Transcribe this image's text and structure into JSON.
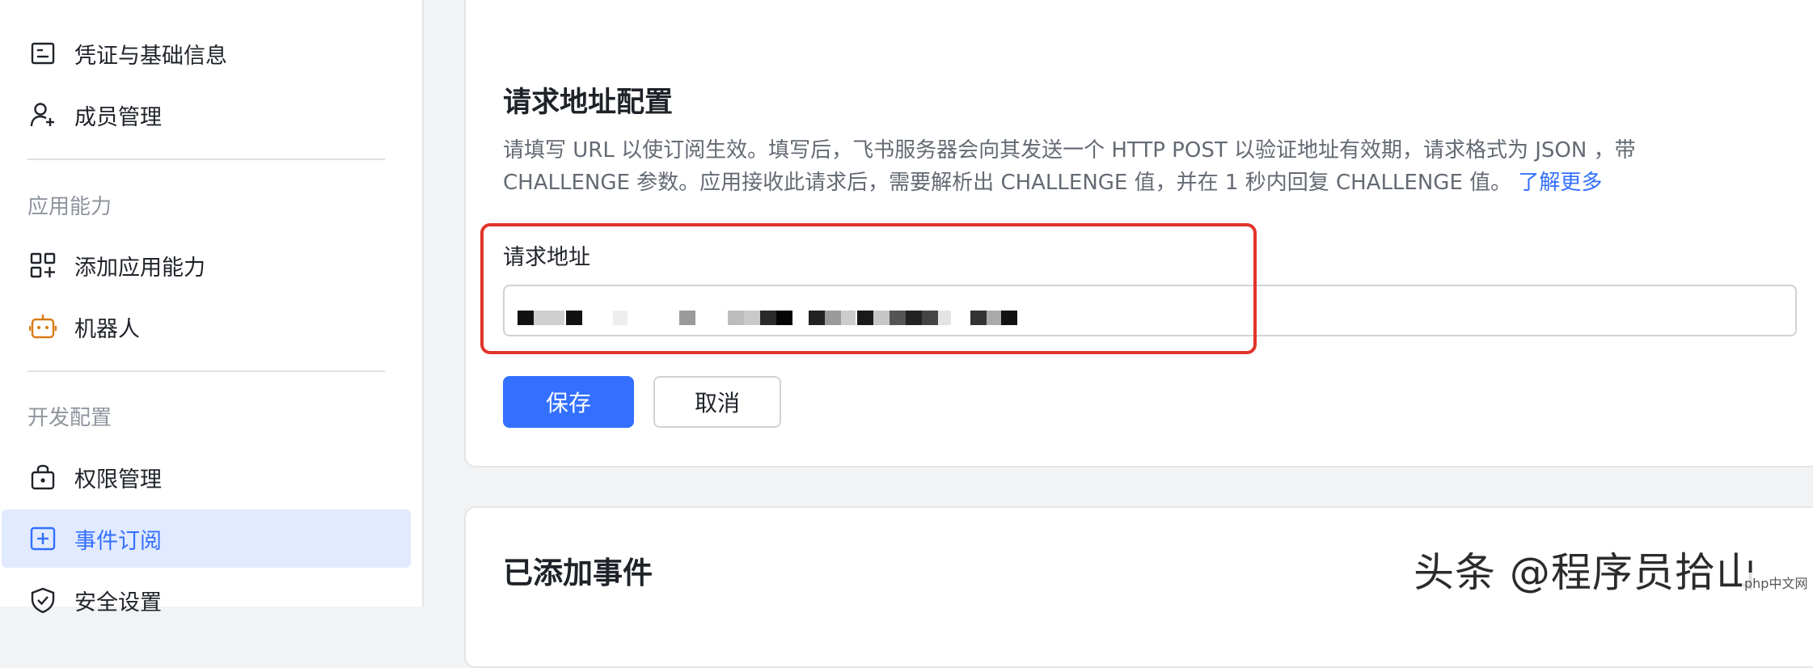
{
  "sidebar": {
    "sections": [
      {
        "label": "应用能力"
      },
      {
        "label": "开发配置"
      }
    ],
    "items": [
      {
        "label": "凭证与基础信息",
        "icon": "credential-card-icon"
      },
      {
        "label": "成员管理",
        "icon": "member-add-icon"
      },
      {
        "label": "添加应用能力",
        "icon": "app-grid-add-icon"
      },
      {
        "label": "机器人",
        "icon": "robot-icon"
      },
      {
        "label": "权限管理",
        "icon": "permission-lock-icon"
      },
      {
        "label": "事件订阅",
        "icon": "event-subscribe-icon"
      },
      {
        "label": "安全设置",
        "icon": "shield-check-icon"
      }
    ],
    "active_item": "事件订阅"
  },
  "request_config": {
    "title": "请求地址配置",
    "description": "请填写 URL 以使订阅生效。填写后，飞书服务器会向其发送一个 HTTP POST 以验证地址有效期，请求格式为 JSON ，带 CHALLENGE 参数。应用接收此请求后，需要解析出 CHALLENGE 值，并在 1 秒内回复 CHALLENGE 值。",
    "learn_more": "了解更多",
    "field_label": "请求地址",
    "save_label": "保存",
    "cancel_label": "取消"
  },
  "events": {
    "title": "已添加事件"
  },
  "watermark": {
    "text": "头条 @程序员拾山",
    "small": "php中文网"
  },
  "colors": {
    "accent": "#3370ff",
    "active_bg": "#e1eaff",
    "highlight": "#e0342b"
  }
}
